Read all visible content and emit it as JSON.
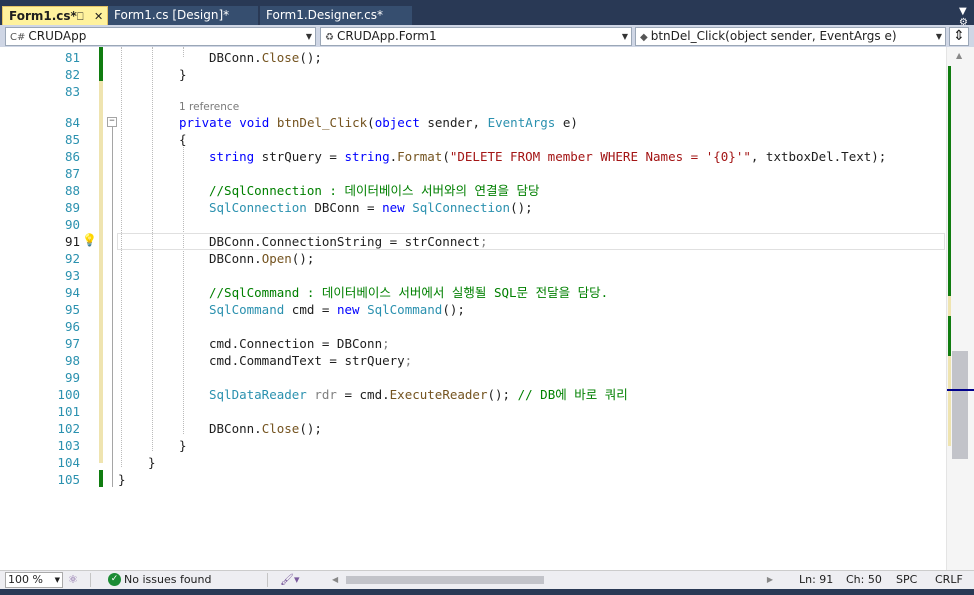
{
  "tabs": [
    {
      "label": "Form1.cs*",
      "active": true,
      "pin": "⎕",
      "close": "✕"
    },
    {
      "label": "Form1.cs [Design]*",
      "active": false
    },
    {
      "label": "Form1.Designer.cs*",
      "active": false
    }
  ],
  "navbar": {
    "project": "CRUDApp",
    "type": "CRUDApp.Form1",
    "member": "btnDel_Click(object sender, EventArgs e)"
  },
  "editor": {
    "reference_hint": "1 reference",
    "current_line": 91,
    "lines": [
      {
        "n": "81"
      },
      {
        "n": "82"
      },
      {
        "n": "83"
      },
      {
        "n": "84"
      },
      {
        "n": "85"
      },
      {
        "n": "86"
      },
      {
        "n": "87"
      },
      {
        "n": "88"
      },
      {
        "n": "89"
      },
      {
        "n": "90"
      },
      {
        "n": "91"
      },
      {
        "n": "92"
      },
      {
        "n": "93"
      },
      {
        "n": "94"
      },
      {
        "n": "95"
      },
      {
        "n": "96"
      },
      {
        "n": "97"
      },
      {
        "n": "98"
      },
      {
        "n": "99"
      },
      {
        "n": "100"
      },
      {
        "n": "101"
      },
      {
        "n": "102"
      },
      {
        "n": "103"
      },
      {
        "n": "104"
      },
      {
        "n": "105"
      }
    ],
    "code": {
      "l81_a": "DBConn",
      "l81_b": ".",
      "l81_c": "Close",
      "l81_d": "();",
      "l82": "}",
      "l84_kw1": "private",
      "l84_kw2": "void",
      "l84_name": "btnDel_Click",
      "l84_p1": "(",
      "l84_kw3": "object",
      "l84_p2": " sender, ",
      "l84_ty": "EventArgs",
      "l84_p3": " e)",
      "l85": "{",
      "l86_kw": "string",
      "l86_a": " strQuery = ",
      "l86_kw2": "string",
      "l86_b": ".",
      "l86_m": "Format",
      "l86_c": "(",
      "l86_str": "\"DELETE FROM member WHERE Names = '{0}'\"",
      "l86_d": ", txtboxDel.Text);",
      "l88_cm": "//SqlConnection : 데이터베이스 서버와의 연결을 담당",
      "l89_ty": "SqlConnection",
      "l89_a": " DBConn = ",
      "l89_kw": "new",
      "l89_sp": " ",
      "l89_ty2": "SqlConnection",
      "l89_b": "();",
      "l91_a": "DBConn.ConnectionString = strConnect",
      "l91_b": ";",
      "l92_a": "DBConn.",
      "l92_m": "Open",
      "l92_b": "();",
      "l94_cm": "//SqlCommand : 데이터베이스 서버에서 실행될 SQL문 전달을 담당.",
      "l95_ty": "SqlCommand",
      "l95_a": " cmd = ",
      "l95_kw": "new",
      "l95_sp": " ",
      "l95_ty2": "SqlCommand",
      "l95_b": "();",
      "l97_a": "cmd.Connection = DBConn",
      "l97_b": ";",
      "l98_a": "cmd.CommandText = strQuery",
      "l98_b": ";",
      "l100_ty": "SqlDataReader",
      "l100_sp": " ",
      "l100_var": "rdr",
      "l100_a": " = cmd.",
      "l100_m": "ExecuteReader",
      "l100_b": "(); ",
      "l100_cm": "// DB에 바로 쿼리",
      "l102_a": "DBConn.",
      "l102_m": "Close",
      "l102_b": "();",
      "l103": "}",
      "l104": "}",
      "l105": "}"
    }
  },
  "statusbar": {
    "zoom": "100 %",
    "issues": "No issues found",
    "line": "Ln: 91",
    "char": "Ch: 50",
    "spacing": "SPC",
    "line_ending": "CRLF"
  },
  "colors": {
    "accent_tab": "#fff29d",
    "chrome": "#293955",
    "change_saved": "#107c10",
    "change_unsaved": "#efe4b0"
  }
}
